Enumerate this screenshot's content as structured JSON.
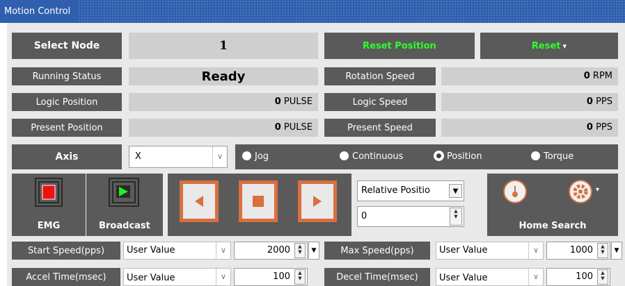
{
  "window": {
    "title": "Motion Control"
  },
  "row1": {
    "select_node_label": "Select Node",
    "node_value": "1",
    "reset_position_label": "Reset Position",
    "reset_label": "Reset",
    "reset_arrow": "▾"
  },
  "status": {
    "running_status_label": "Running Status",
    "running_status_value": "Ready",
    "rotation_speed_label": "Rotation Speed",
    "rotation_speed_value": "0",
    "rotation_speed_unit": "RPM",
    "logic_position_label": "Logic Position",
    "logic_position_value": "0",
    "logic_position_unit": "PULSE",
    "logic_speed_label": "Logic Speed",
    "logic_speed_value": "0",
    "logic_speed_unit": "PPS",
    "present_position_label": "Present Position",
    "present_position_value": "0",
    "present_position_unit": "PULSE",
    "present_speed_label": "Present Speed",
    "present_speed_value": "0",
    "present_speed_unit": "PPS"
  },
  "axis": {
    "label": "Axis",
    "selected": "X",
    "modes": [
      {
        "label": "Jog",
        "selected": false
      },
      {
        "label": "Continuous",
        "selected": false
      },
      {
        "label": "Position",
        "selected": true
      },
      {
        "label": "Torque",
        "selected": false
      }
    ]
  },
  "controls": {
    "emg_label": "EMG",
    "broadcast_label": "Broadcast",
    "position_mode": "Relative Positio",
    "position_value": "0",
    "home_search_label": "Home Search"
  },
  "params": {
    "start_speed_label": "Start Speed(pps)",
    "start_speed_mode": "User Value",
    "start_speed_value": "2000",
    "max_speed_label": "Max Speed(pps)",
    "max_speed_mode": "User Value",
    "max_speed_value": "1000",
    "accel_time_label": "Accel Time(msec)",
    "accel_time_mode": "User Value",
    "accel_time_value": "100",
    "decel_time_label": "Decel Time(msec)",
    "decel_time_mode": "User Value",
    "decel_time_value": "100"
  },
  "colors": {
    "title_bar": "#2f5fae",
    "dark_cell": "#5a5a5a",
    "light_cell": "#cfcfcf",
    "accent_green": "#2dff2d",
    "accent_orange": "#d9703f"
  }
}
